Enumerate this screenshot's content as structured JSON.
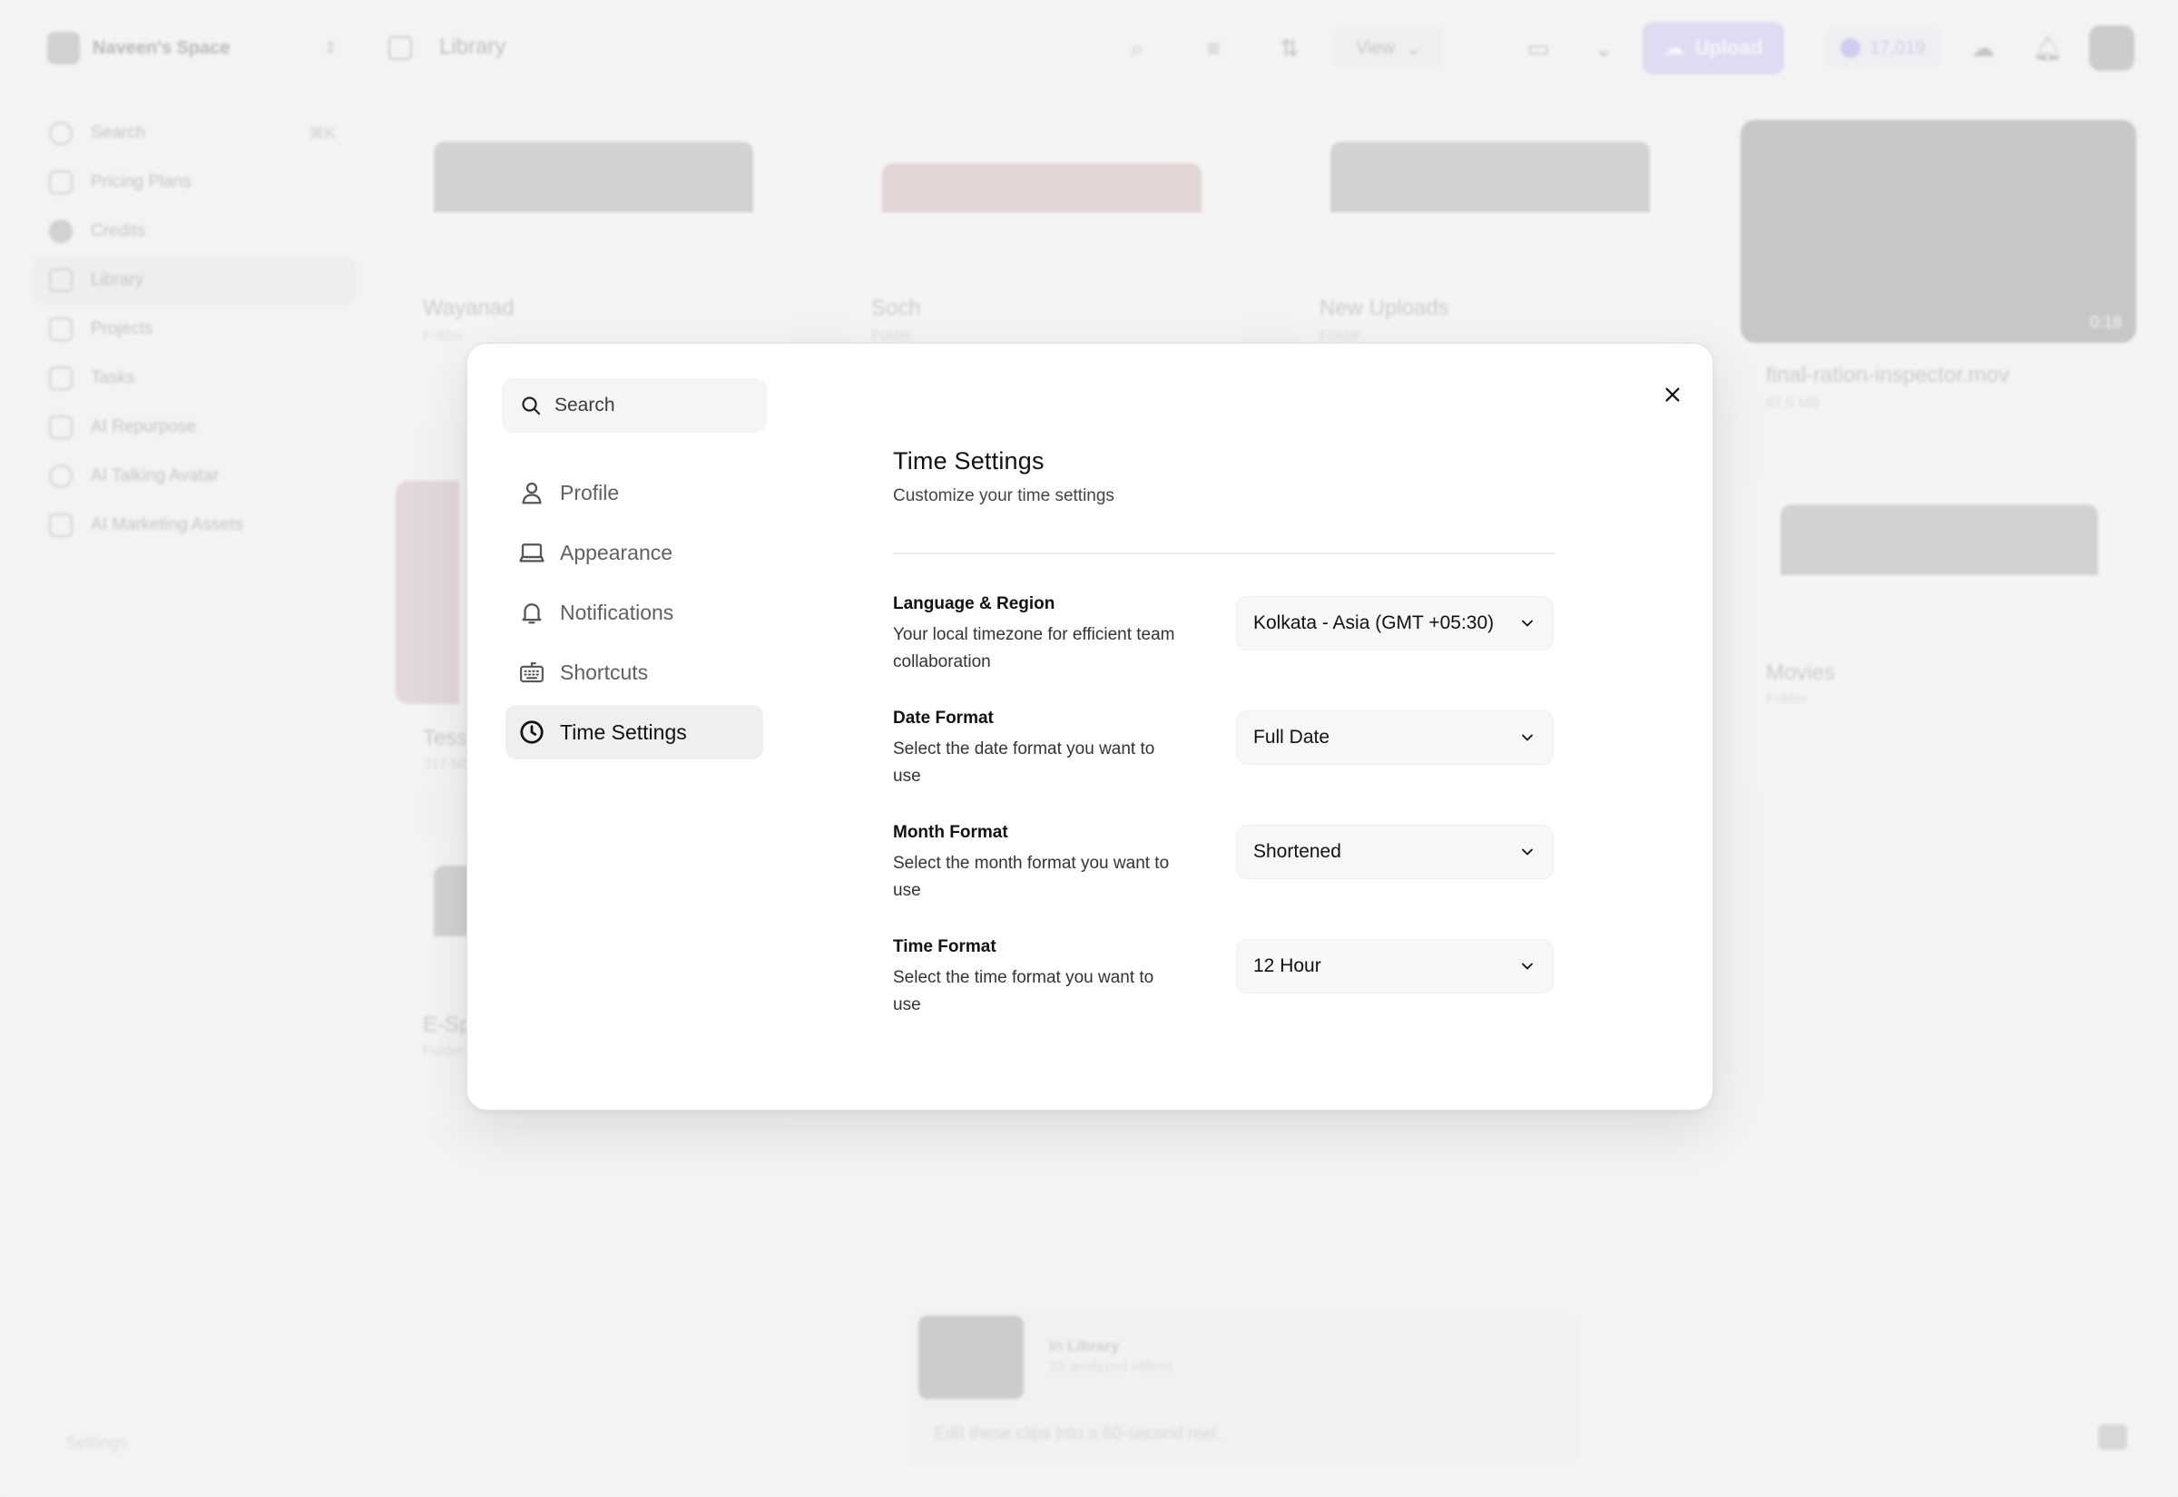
{
  "workspace": {
    "name": "Naveen's Space"
  },
  "header": {
    "breadcrumb": "Library",
    "view_label": "View",
    "upload_label": "Upload",
    "credits": "17,019"
  },
  "sidebar": {
    "search_label": "Search",
    "search_shortcut": "⌘K",
    "items": [
      {
        "label": "Pricing Plans",
        "icon": "tag-icon"
      },
      {
        "label": "Credits",
        "icon": "coin-icon"
      },
      {
        "label": "Library",
        "icon": "folder-icon"
      },
      {
        "label": "Projects",
        "icon": "archive-icon"
      },
      {
        "label": "Tasks",
        "icon": "layers-icon"
      },
      {
        "label": "AI Repurpose",
        "icon": "film-icon"
      },
      {
        "label": "AI Talking Avatar",
        "icon": "avatar-icon"
      },
      {
        "label": "AI Marketing Assets",
        "icon": "store-icon"
      }
    ],
    "settings_label": "Settings"
  },
  "library": {
    "cards": [
      {
        "title": "Wayanad",
        "sub": "Folder"
      },
      {
        "title": "Soch",
        "sub": "Folder"
      },
      {
        "title": "New Uploads",
        "sub": "Folder"
      },
      {
        "title": "final-ration-inspector.mov",
        "sub": "82.5 MB",
        "duration": "0:18"
      },
      {
        "title": "Tess",
        "sub": "317 MB"
      },
      {
        "title": "Movies",
        "sub": "Folder"
      },
      {
        "title": "E-Sp",
        "sub": "Folder"
      }
    ]
  },
  "chat": {
    "title": "In Library",
    "subtitle": "28 analyzed videos",
    "input_placeholder": "Edit these clips into a 60-second reel."
  },
  "modal": {
    "search_placeholder": "Search",
    "nav": [
      {
        "label": "Profile",
        "icon": "user-icon"
      },
      {
        "label": "Appearance",
        "icon": "laptop-icon"
      },
      {
        "label": "Notifications",
        "icon": "bell-icon"
      },
      {
        "label": "Shortcuts",
        "icon": "keyboard-icon"
      },
      {
        "label": "Time Settings",
        "icon": "clock-icon",
        "active": true
      }
    ],
    "title": "Time Settings",
    "subtitle": "Customize your time settings",
    "settings": [
      {
        "label": "Language & Region",
        "description": "Your local timezone for efficient team collaboration",
        "value": "Kolkata - Asia (GMT +05:30)"
      },
      {
        "label": "Date Format",
        "description": "Select the date format you want to use",
        "value": "Full Date"
      },
      {
        "label": "Month Format",
        "description": "Select the month format you want to use",
        "value": "Shortened"
      },
      {
        "label": "Time Format",
        "description": "Select the time format you want to use",
        "value": "12 Hour"
      }
    ]
  }
}
